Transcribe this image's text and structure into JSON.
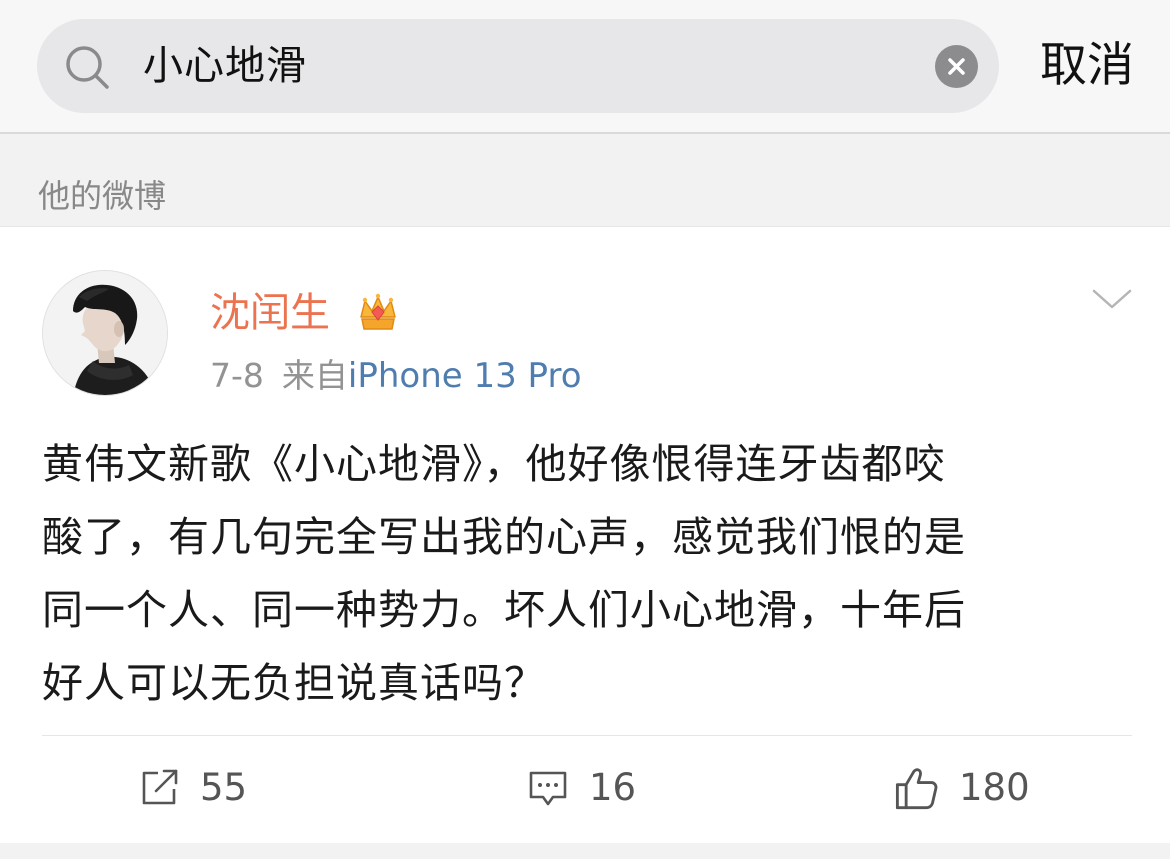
{
  "search": {
    "query": "小心地滑",
    "cancel_label": "取消"
  },
  "section": {
    "label": "他的微博"
  },
  "post": {
    "author": "沈闰生",
    "date": "7-8",
    "from_label": "来自",
    "source": "iPhone 13 Pro",
    "body_lines": [
      "黄伟文新歌《小心地滑》，他好像恨得连牙齿都咬",
      "酸了，有几句完全写出我的心声，感觉我们恨的是",
      "同一个人、同一种势力。坏人们小心地滑，十年后",
      "好人可以无负担说真话吗？"
    ],
    "reposts": "55",
    "comments": "16",
    "likes": "180"
  },
  "icons": {
    "search": "search-icon",
    "clear": "clear-icon",
    "crown": "crown-icon",
    "chevron": "chevron-down-icon",
    "repost": "repost-icon",
    "comment": "comment-icon",
    "like": "thumbs-up-icon"
  },
  "colors": {
    "author_name": "#eb7350",
    "source_link": "#507daf",
    "meta_text": "#939393",
    "crown": "#f4a52a"
  }
}
